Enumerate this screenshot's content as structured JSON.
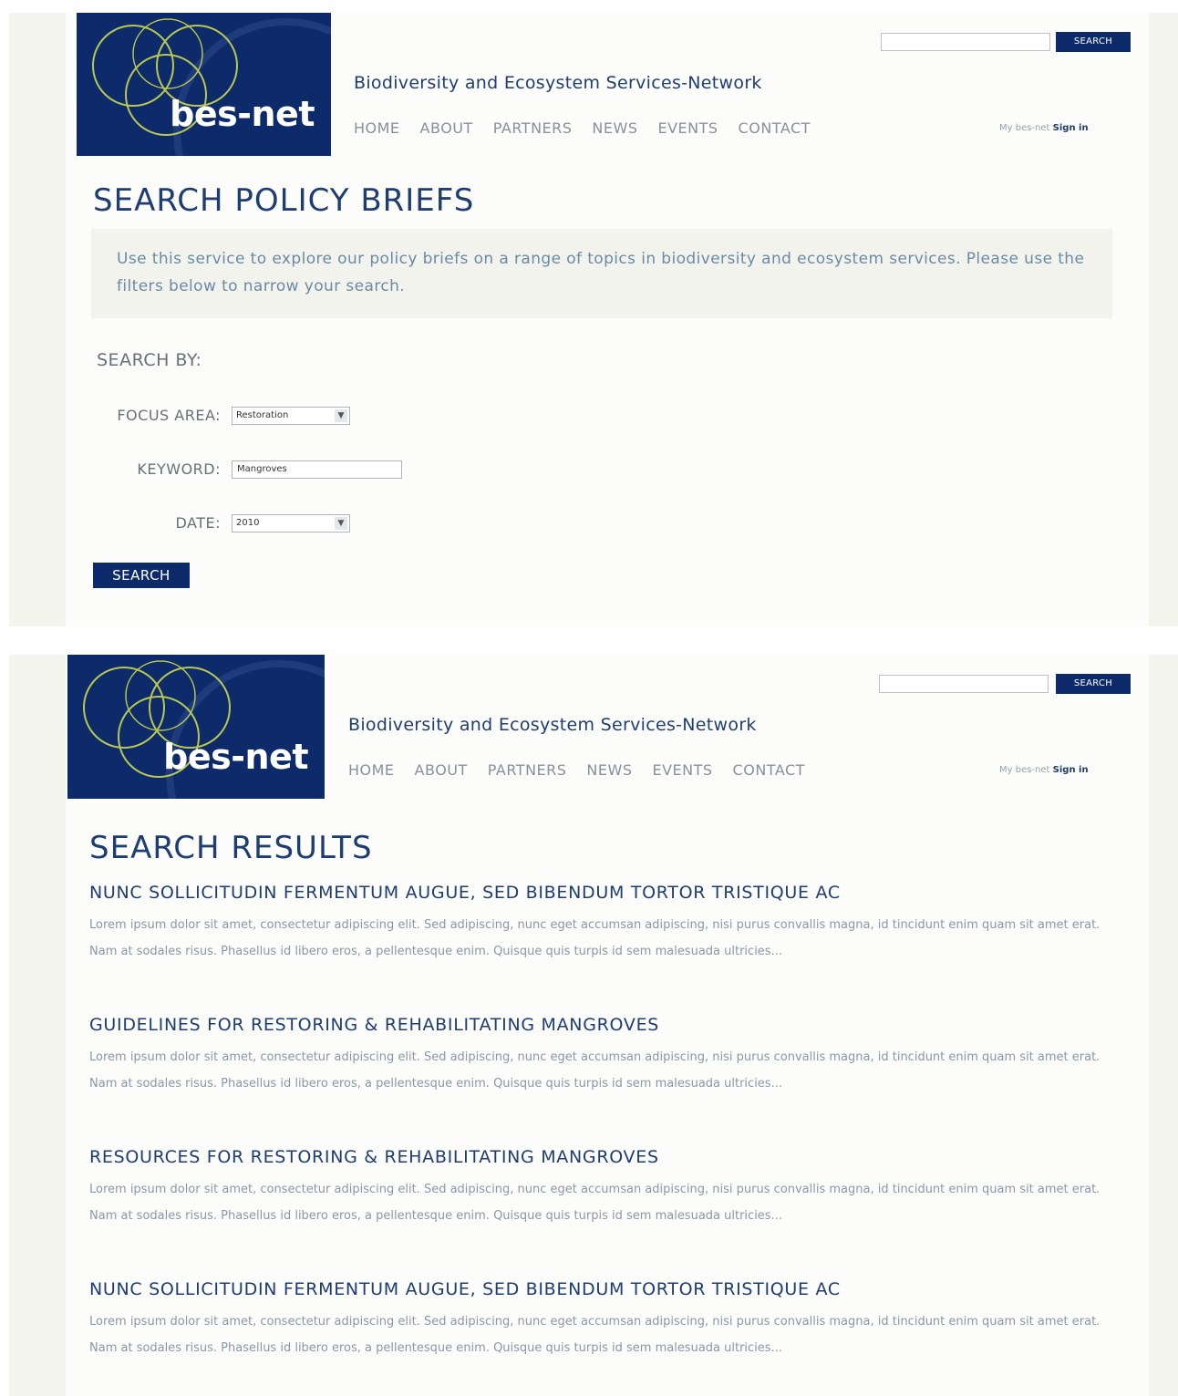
{
  "colors": {
    "brand_navy": "#0d2a6a",
    "heading_blue": "#1e3d73",
    "intro_text": "#6b8aa6"
  },
  "header": {
    "logo_text": "bes-net",
    "site_title": "Biodiversity and Ecosystem Services-Network",
    "search_button": "SEARCH",
    "nav": [
      "HOME",
      "ABOUT",
      "PARTNERS",
      "NEWS",
      "EVENTS",
      "CONTACT"
    ],
    "my_besnet": "My bes-net",
    "sign_in": "Sign in"
  },
  "search_page": {
    "heading": "SEARCH POLICY BRIEFS",
    "intro": "Use this service to explore our policy briefs on a range of topics in biodiversity and ecosystem services.  Please use the filters below to narrow your search.",
    "search_by": "SEARCH BY:",
    "focus_area_label": "FOCUS AREA:",
    "focus_area_value": "Restoration",
    "keyword_label": "KEYWORD:",
    "keyword_value": "Mangroves",
    "date_label": "DATE:",
    "date_value": "2010",
    "submit_label": "SEARCH"
  },
  "results_page": {
    "heading": "SEARCH RESULTS",
    "results": [
      {
        "title": "NUNC SOLLICITUDIN FERMENTUM AUGUE, SED BIBENDUM TORTOR TRISTIQUE AC",
        "summary": "Lorem ipsum dolor sit amet, consectetur adipiscing elit. Sed adipiscing, nunc eget accumsan adipiscing, nisi purus convallis magna, id tincidunt enim quam sit amet erat. Nam at sodales risus. Phasellus id libero eros, a pellentesque enim. Quisque quis turpis id sem malesuada ultricies..."
      },
      {
        "title": "GUIDELINES FOR RESTORING & REHABILITATING MANGROVES",
        "summary": "Lorem ipsum dolor sit amet, consectetur adipiscing elit. Sed adipiscing, nunc eget accumsan adipiscing, nisi purus convallis magna, id tincidunt enim quam sit amet erat. Nam at sodales risus. Phasellus id libero eros, a pellentesque enim. Quisque quis turpis id sem malesuada ultricies..."
      },
      {
        "title": "RESOURCES FOR RESTORING & REHABILITATING MANGROVES",
        "summary": "Lorem ipsum dolor sit amet, consectetur adipiscing elit. Sed adipiscing, nunc eget accumsan adipiscing, nisi purus convallis magna, id tincidunt enim quam sit amet erat. Nam at sodales risus. Phasellus id libero eros, a pellentesque enim. Quisque quis turpis id sem malesuada ultricies..."
      },
      {
        "title": "NUNC SOLLICITUDIN FERMENTUM AUGUE, SED BIBENDUM TORTOR TRISTIQUE AC",
        "summary": "Lorem ipsum dolor sit amet, consectetur adipiscing elit. Sed adipiscing, nunc eget accumsan adipiscing, nisi purus convallis magna, id tincidunt enim quam sit amet erat. Nam at sodales risus. Phasellus id libero eros, a pellentesque enim. Quisque quis turpis id sem malesuada ultricies..."
      }
    ]
  }
}
